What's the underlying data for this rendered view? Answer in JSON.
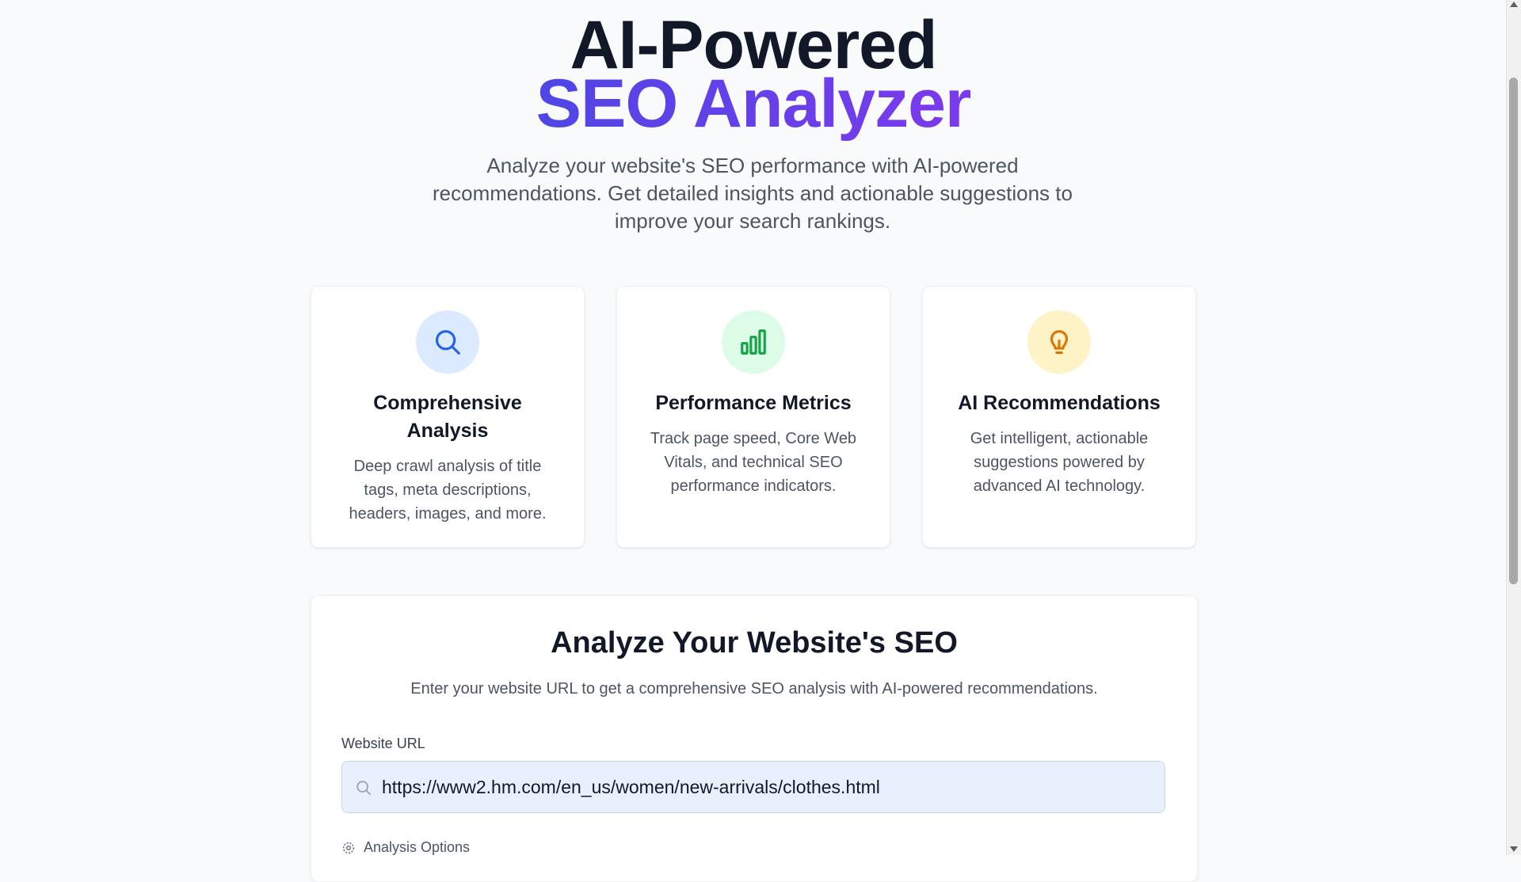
{
  "hero": {
    "title_line1": "AI-Powered",
    "title_line2": "SEO Analyzer",
    "subtitle": "Analyze your website's SEO performance with AI-powered recommendations. Get detailed insights and actionable suggestions to improve your search rankings."
  },
  "features": [
    {
      "icon": "search-icon",
      "icon_color": "#2563eb",
      "icon_bg": "#dbeafe",
      "title": "Comprehensive Analysis",
      "description": "Deep crawl analysis of title tags, meta descriptions, headers, images, and more."
    },
    {
      "icon": "bar-chart-icon",
      "icon_color": "#16a34a",
      "icon_bg": "#dcfce7",
      "title": "Performance Metrics",
      "description": "Track page speed, Core Web Vitals, and technical SEO performance indicators."
    },
    {
      "icon": "lightbulb-icon",
      "icon_color": "#d97706",
      "icon_bg": "#fef3c7",
      "title": "AI Recommendations",
      "description": "Get intelligent, actionable suggestions powered by advanced AI technology."
    }
  ],
  "form": {
    "title": "Analyze Your Website's SEO",
    "subtitle": "Enter your website URL to get a comprehensive SEO analysis with AI-powered recommendations.",
    "url_label": "Website URL",
    "url_value": "https://www2.hm.com/en_us/women/new-arrivals/clothes.html",
    "options_label": "Analysis Options"
  },
  "colors": {
    "accent_start": "#4f46e5",
    "accent_end": "#7c3aed",
    "background": "#f9fafb"
  }
}
